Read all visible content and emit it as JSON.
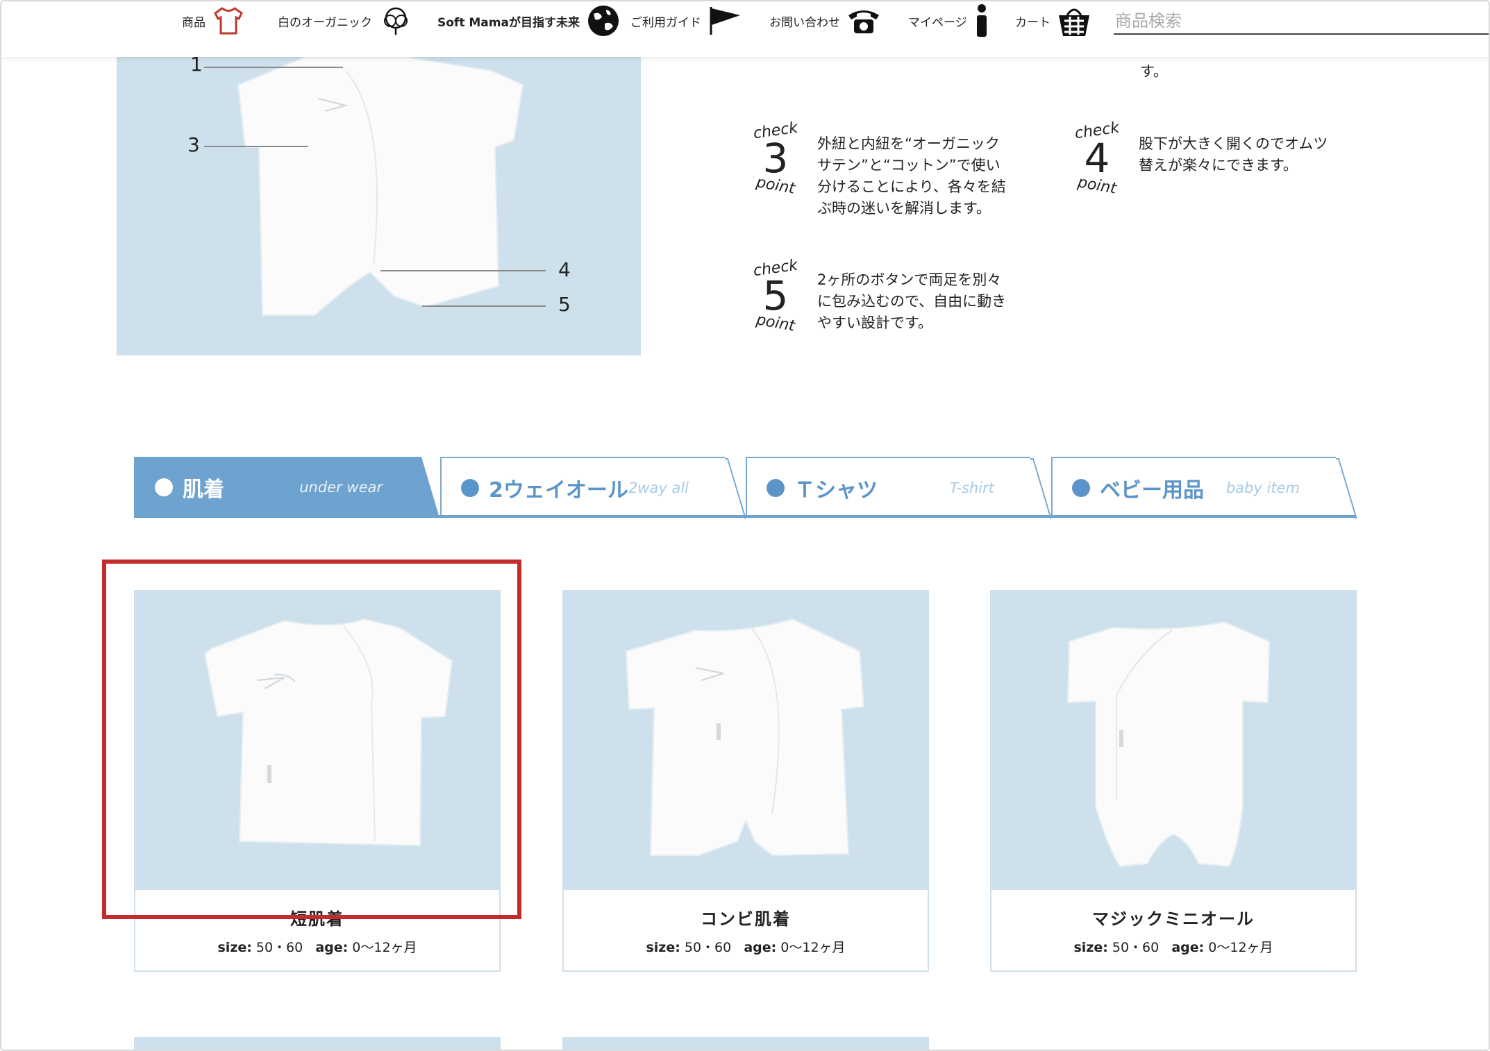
{
  "header": {
    "nav": [
      {
        "label": "商品",
        "icon": "t-shirt-icon",
        "color": "#c0392b"
      },
      {
        "label": "白のオーガニック",
        "icon": "cotton-icon"
      },
      {
        "label": "Soft Mamaが目指す未来",
        "icon": "globe-icon"
      },
      {
        "label": "ご利用ガイド",
        "icon": "flag-icon"
      },
      {
        "label": "お問い合わせ",
        "icon": "telephone-icon"
      },
      {
        "label": "マイページ",
        "icon": "info-icon"
      },
      {
        "label": "カート",
        "icon": "basket-icon"
      }
    ],
    "search_placeholder": "商品検索"
  },
  "hero": {
    "callouts": [
      "1",
      "3",
      "4",
      "5"
    ]
  },
  "checkpoints": {
    "top_fragment": "す。",
    "word_check": "check",
    "word_point": "point",
    "items": [
      {
        "number": "3",
        "text": [
          "外紐と内紐を“オーガニック",
          "サテン”と“コットン”で使い",
          "分けることにより、各々を結",
          "ぶ時の迷いを解消します。"
        ]
      },
      {
        "number": "4",
        "text": [
          "股下が大きく開くのでオムツ",
          "替えが楽々にできます。"
        ]
      },
      {
        "number": "5",
        "text": [
          "2ヶ所のボタンで両足を別々",
          "に包み込むので、自由に動き",
          "やすい設計です。"
        ]
      }
    ]
  },
  "tabs": [
    {
      "label": "肌着",
      "en": "under wear",
      "active": true
    },
    {
      "label": "2ウェイオール",
      "en": "2way all",
      "active": false
    },
    {
      "label": "Ｔシャツ",
      "en": "T-shirt",
      "active": false
    },
    {
      "label": "ベビー用品",
      "en": "baby item",
      "active": false
    }
  ],
  "products": [
    {
      "name": "短肌着",
      "size_label": "size:",
      "size": "50・60",
      "age_label": "age:",
      "age": "0〜12ヶ月"
    },
    {
      "name": "コンビ肌着",
      "size_label": "size:",
      "size": "50・60",
      "age_label": "age:",
      "age": "0〜12ヶ月"
    },
    {
      "name": "マジックミニオール",
      "size_label": "size:",
      "size": "50・60",
      "age_label": "age:",
      "age": "0〜12ヶ月"
    }
  ],
  "colors": {
    "accent": "#6ea2cf",
    "image_bg": "#cde0ec",
    "highlight": "#c42b2b"
  }
}
